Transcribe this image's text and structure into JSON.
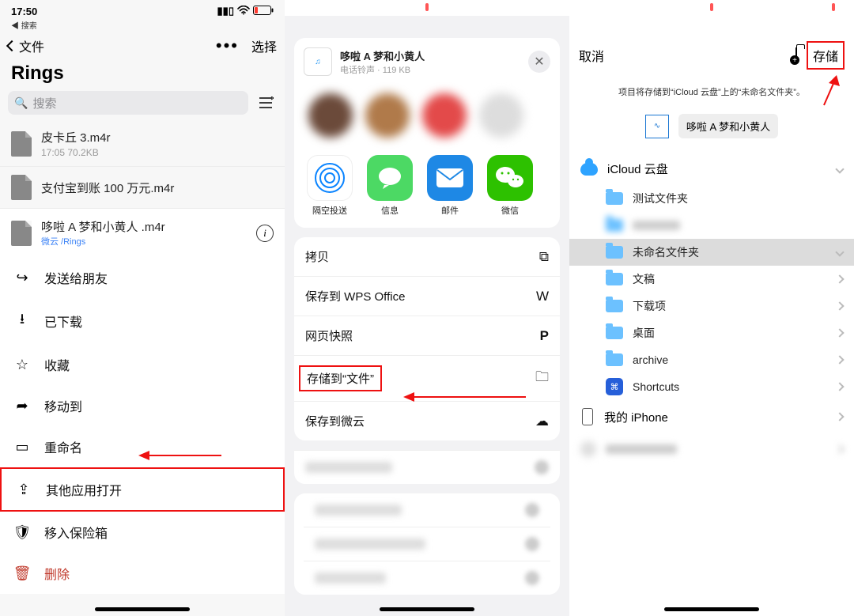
{
  "p1": {
    "status_time": "17:50",
    "status_footnote": "◀ 搜索",
    "back_label": "文件",
    "select_label": "选择",
    "title": "Rings",
    "search_placeholder": "搜索",
    "files": [
      {
        "name": "皮卡丘 3.m4r",
        "meta": "17:05 70.2KB"
      },
      {
        "name": "支付宝到账 100 万元.m4r",
        "meta": ""
      }
    ],
    "selected": {
      "name": "哆啦 A 梦和小黄人 .m4r",
      "breadcrumb": "微云 /Rings"
    },
    "actions": {
      "send": "发送给朋友",
      "downloaded": "已下载",
      "favorite": "收藏",
      "move": "移动到",
      "rename": "重命名",
      "open_with": "其他应用打开",
      "vault": "移入保险箱",
      "delete": "删除"
    }
  },
  "p2": {
    "file": {
      "name": "哆啦 A 梦和小黄人",
      "meta": "电话铃声 · 119 KB"
    },
    "apps": {
      "airdrop": "隔空投送",
      "messages": "信息",
      "mail": "邮件",
      "wechat": "微信"
    },
    "options": {
      "copy": "拷贝",
      "wps": "保存到 WPS Office",
      "snapshot": "网页快照",
      "save_files": "存储到“文件”",
      "weiyun": "保存到微云"
    }
  },
  "p3": {
    "cancel": "取消",
    "save": "存储",
    "where": "项目将存储到“iCloud 云盘”上的“未命名文件夹”。",
    "chip": "哆啦 A 梦和小黄人",
    "icloud": "iCloud 云盘",
    "folders": {
      "test": "测试文件夹",
      "untitled": "未命名文件夹",
      "docs": "文稿",
      "downloads": "下载项",
      "desktop": "桌面",
      "archive": "archive",
      "shortcuts": "Shortcuts"
    },
    "my_iphone": "我的 iPhone"
  }
}
